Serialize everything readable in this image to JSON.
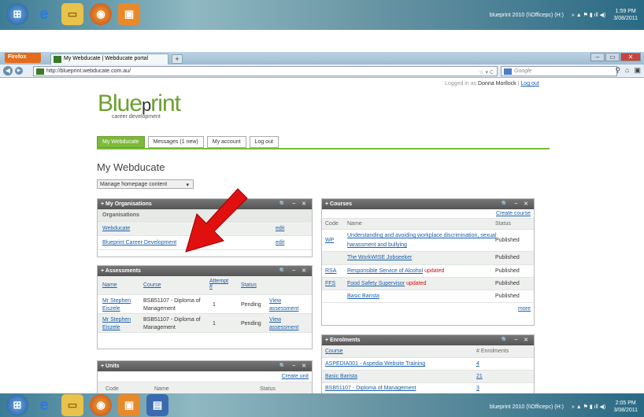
{
  "taskbar_top": {
    "clock_time": "1:59 PM",
    "clock_date": "3/08/2011",
    "tray_label": "blueprint 2010 (\\\\Officepc) (H:)"
  },
  "taskbar_bottom": {
    "clock_time": "2:05 PM",
    "clock_date": "3/08/2011",
    "tray_label": "blueprint 2010 (\\\\Officepc) (H:)"
  },
  "browser": {
    "firefox_label": "Firefox",
    "tab_title": "My Webducate | Webducate portal",
    "new_tab": "+",
    "url": "http://blueprint.webducate.com.au/",
    "search_placeholder": "Google"
  },
  "header": {
    "logged_in_prefix": "Logged in as",
    "user": "Donna Morllock",
    "logout": "Log out",
    "logo_word_1": "Blue",
    "logo_word_2": "rint",
    "logo_sub": "career development"
  },
  "nav": {
    "tabs": [
      "My Webducate",
      "Messages (1 new)",
      "My account",
      "Log out"
    ]
  },
  "page_title": "My Webducate",
  "manage_select": "Manage homepage content",
  "organisations": {
    "title": "My Organisations",
    "header": "Organisations",
    "rows": [
      {
        "name": "Webducate",
        "action": "edit"
      },
      {
        "name": "Blueprint Career Development",
        "action": "edit"
      }
    ]
  },
  "assessments": {
    "title": "Assessments",
    "cols": [
      "Name",
      "Course",
      "Attempt #",
      "Status"
    ],
    "rows": [
      {
        "name": "Mr Stephen Eiszele",
        "course": "BSB51107 - Diploma of Management",
        "attempt": "1",
        "status": "Pending",
        "action": "View assessment"
      },
      {
        "name": "Mr Stephen Eiszele",
        "course": "BSB51107 - Diploma of Management",
        "attempt": "1",
        "status": "Pending",
        "action": "View assessment"
      }
    ]
  },
  "units": {
    "title": "Units",
    "create": "Create unit",
    "cols": [
      "Code",
      "Name",
      "Status"
    ]
  },
  "courses": {
    "title": "Courses",
    "create": "Create course",
    "cols": [
      "Code",
      "Name",
      "Status"
    ],
    "rows": [
      {
        "code": "WP",
        "name": "Understanding and avoiding workplace discrimination, sexual harassment and bullying",
        "updated": "",
        "status": "Published"
      },
      {
        "code": "",
        "name": "The WorkWISE Jobseeker",
        "updated": "",
        "status": "Published"
      },
      {
        "code": "RSA",
        "name": "Responsible Service of Alcohol",
        "updated": "updated",
        "status": "Published"
      },
      {
        "code": "FFS",
        "name": "Food Safety Supervisor",
        "updated": "updated",
        "status": "Published"
      },
      {
        "code": "",
        "name": "Basic Barista",
        "updated": "",
        "status": "Published"
      }
    ],
    "more": "more"
  },
  "enrolments": {
    "title": "Enrolments",
    "cols": [
      "Course",
      "# Enrolments"
    ],
    "rows": [
      {
        "course": "ASPEDIA001 - Aspedia Website Training",
        "count": "4"
      },
      {
        "course": "Basic Barista",
        "count": "21"
      },
      {
        "course": "BSB51107 - Diploma of Management",
        "count": "3"
      }
    ]
  },
  "colors": {
    "brand_green": "#7cba3a",
    "arrow_red": "#e01010",
    "updated_red": "#d01010"
  }
}
